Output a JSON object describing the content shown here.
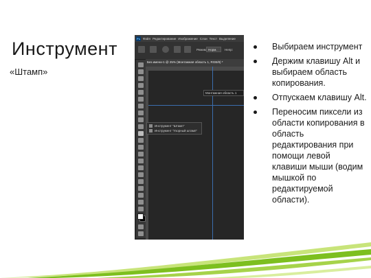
{
  "slide": {
    "title": "Инструмент",
    "subtitle": "«Штамп»"
  },
  "photoshop": {
    "logo": "Ps",
    "menu": [
      "Файл",
      "Редактирование",
      "Изображение",
      "Слои",
      "Текст",
      "Выделение"
    ],
    "options": {
      "mode_label": "Режим:",
      "mode_value": "Норм.",
      "opacity_label": "Непр:"
    },
    "document_tab": "Без имени-1 @ 25% (Монтажная область 1, RGB/8) *",
    "artboard_label": "Монтажная область 1",
    "flyout": [
      "Инструмент \"Штамп\"",
      "Инструмент \"Узорный штамп\""
    ]
  },
  "bullets": [
    "Выбираем инструмент",
    "Держим клавишу Alt и выбираем область копирования.",
    "Отпускаем клавишу Alt.",
    "Переносим пиксели из области копирования в область редактирования при помощи левой клавиши мыши (водим мышкой по редактируемой области)."
  ],
  "colors": {
    "accent_green": "#7dbf1f",
    "light_green": "#c8e47a",
    "app_dark": "#282828",
    "guide_blue": "#3c6fb0"
  }
}
